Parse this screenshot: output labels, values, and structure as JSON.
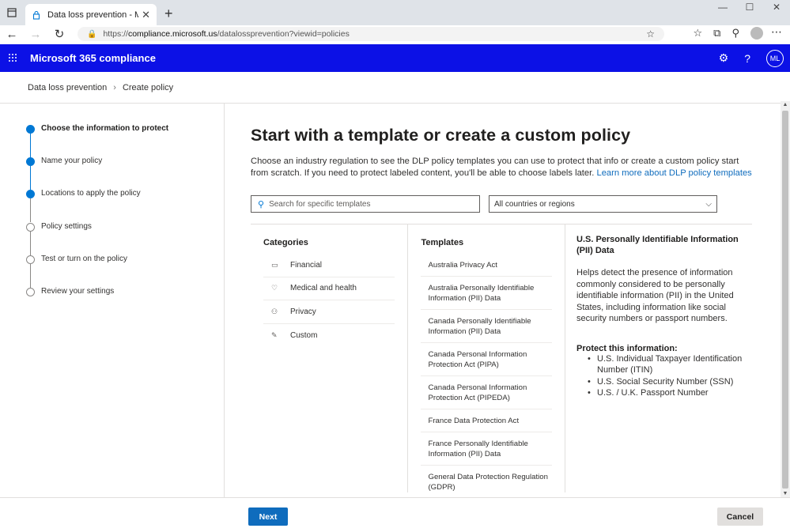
{
  "browser": {
    "tab_title": "Data loss prevention - Microsoft",
    "url_prefix": "https://",
    "url_host": "compliance.microsoft.us",
    "url_path": "/datalossprevention?viewid=policies"
  },
  "app": {
    "name": "Microsoft 365 compliance",
    "avatar_initials": "ML",
    "accent_color": "#0c11e6"
  },
  "breadcrumb": [
    "Data loss prevention",
    "Create policy"
  ],
  "steps": [
    {
      "label": "Choose the information to protect",
      "state": "active"
    },
    {
      "label": "Name your policy",
      "state": "done"
    },
    {
      "label": "Locations to apply the policy",
      "state": "done"
    },
    {
      "label": "Policy settings",
      "state": "todo"
    },
    {
      "label": "Test or turn on the policy",
      "state": "todo"
    },
    {
      "label": "Review your settings",
      "state": "todo"
    }
  ],
  "main": {
    "title": "Start with a template or create a custom policy",
    "description": "Choose an industry regulation to see the DLP policy templates you can use to protect that info or create a custom policy start from scratch. If you need to protect labeled content, you'll be able to choose labels later. ",
    "learn_more": "Learn more about DLP policy templates",
    "search_placeholder": "Search for specific templates",
    "country_select": "All countries or regions"
  },
  "categories": {
    "heading": "Categories",
    "items": [
      {
        "label": "Financial",
        "icon": "financial-icon"
      },
      {
        "label": "Medical and health",
        "icon": "heart-icon"
      },
      {
        "label": "Privacy",
        "icon": "privacy-icon"
      },
      {
        "label": "Custom",
        "icon": "pencil-icon"
      }
    ]
  },
  "templates": {
    "heading": "Templates",
    "items": [
      "Australia Privacy Act",
      "Australia Personally Identifiable Information (PII) Data",
      "Canada Personally Identifiable Information (PII) Data",
      "Canada Personal Information Protection Act (PIPA)",
      "Canada Personal Information Protection Act (PIPEDA)",
      "France Data Protection Act",
      "France Personally Identifiable Information (PII) Data",
      "General Data Protection Regulation (GDPR)"
    ]
  },
  "detail": {
    "title": "U.S. Personally Identifiable Information (PII) Data",
    "description": "Helps detect the presence of information commonly considered to be personally identifiable information (PII) in the United States, including information like social security numbers or passport numbers.",
    "protect_heading": "Protect this information:",
    "protect_items": [
      "U.S. Individual Taxpayer Identification Number (ITIN)",
      "U.S. Social Security Number (SSN)",
      "U.S. / U.K. Passport Number"
    ]
  },
  "footer": {
    "next_label": "Next",
    "cancel_label": "Cancel"
  }
}
